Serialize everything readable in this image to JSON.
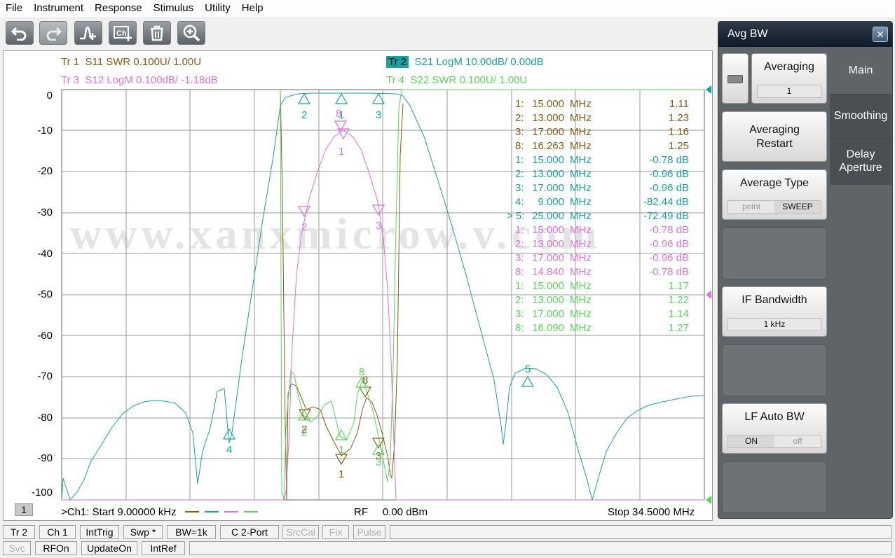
{
  "menu": [
    "File",
    "Instrument",
    "Response",
    "Stimulus",
    "Utility",
    "Help"
  ],
  "toolbar": {
    "undo_icon": "undo-icon",
    "redo_icon": "redo-icon",
    "marker_add_icon": "marker-add-icon",
    "ch_add_icon": "channel-add-icon",
    "delete_icon": "trash-icon",
    "zoom_icon": "zoom-icon",
    "ch_add_text": "Ch"
  },
  "traces": {
    "tr1": {
      "id": "Tr  1",
      "desc": "S11 SWR 0.100U/  1.00U",
      "color": "#8B5A12"
    },
    "tr2": {
      "id": "Tr  2",
      "desc": "S21 LogM 10.00dB/  0.00dB",
      "color": "#14A3A3"
    },
    "tr3": {
      "id": "Tr  3",
      "desc": "S12 LogM 0.100dB/  -1.18dB",
      "color": "#DA73DA"
    },
    "tr4": {
      "id": "Tr  4",
      "desc": "S22 SWR 0.100U/  1.00U",
      "color": "#57D957"
    }
  },
  "y_axis": [
    "0",
    "-10",
    "-20",
    "-30",
    "-40",
    "-50",
    "-60",
    "-70",
    "-80",
    "-90",
    "-100"
  ],
  "watermark": "www.xanxmicrow.v.com",
  "marker_table": [
    {
      "num": "1:",
      "freq": "15.000",
      "unit": "MHz",
      "val": "1.11",
      "trace": "tr1"
    },
    {
      "num": "2:",
      "freq": "13.000",
      "unit": "MHz",
      "val": "1.23",
      "trace": "tr1"
    },
    {
      "num": "3:",
      "freq": "17.000",
      "unit": "MHz",
      "val": "1.16",
      "trace": "tr1"
    },
    {
      "num": "8:",
      "freq": "16.263",
      "unit": "MHz",
      "val": "1.25",
      "trace": "tr1"
    },
    {
      "num": "1:",
      "freq": "15.000",
      "unit": "MHz",
      "val": "-0.78 dB",
      "trace": "tr2"
    },
    {
      "num": "2:",
      "freq": "13.000",
      "unit": "MHz",
      "val": "-0.96 dB",
      "trace": "tr2"
    },
    {
      "num": "3:",
      "freq": "17.000",
      "unit": "MHz",
      "val": "-0.96 dB",
      "trace": "tr2"
    },
    {
      "num": "4:",
      "freq": "9.000",
      "unit": "MHz",
      "val": "-82.44 dB",
      "trace": "tr2"
    },
    {
      "num": "> 5:",
      "freq": "25.000",
      "unit": "MHz",
      "val": "-72.49 dB",
      "trace": "tr2"
    },
    {
      "num": "1:",
      "freq": "15.000",
      "unit": "MHz",
      "val": "-0.78 dB",
      "trace": "tr3"
    },
    {
      "num": "2:",
      "freq": "13.000",
      "unit": "MHz",
      "val": "-0.96 dB",
      "trace": "tr3"
    },
    {
      "num": "3:",
      "freq": "17.000",
      "unit": "MHz",
      "val": "-0.96 dB",
      "trace": "tr3"
    },
    {
      "num": "8:",
      "freq": "14.840",
      "unit": "MHz",
      "val": "-0.78 dB",
      "trace": "tr3"
    },
    {
      "num": "1:",
      "freq": "15.000",
      "unit": "MHz",
      "val": "1.17",
      "trace": "tr4"
    },
    {
      "num": "2:",
      "freq": "13.000",
      "unit": "MHz",
      "val": "1.22",
      "trace": "tr4"
    },
    {
      "num": "3:",
      "freq": "17.000",
      "unit": "MHz",
      "val": "1.14",
      "trace": "tr4"
    },
    {
      "num": "8:",
      "freq": "16.090",
      "unit": "MHz",
      "val": "1.27",
      "trace": "tr4"
    }
  ],
  "channel_num": "1",
  "bottom": {
    "start": ">Ch1:  Start  9.00000 kHz",
    "rf": "RF     0.00 dBm",
    "stop": "Stop  34.5000 MHz"
  },
  "panel": {
    "title": "Avg BW",
    "close": "✕",
    "averaging": {
      "label": "Averaging",
      "value": "1"
    },
    "restart": "Averaging\nRestart",
    "avg_type": {
      "label": "Average Type",
      "opt1": "point",
      "opt2": "SWEEP"
    },
    "if_bw": {
      "label": "IF Bandwidth",
      "value": "1 kHz"
    },
    "lf_auto": {
      "label": "LF Auto BW",
      "opt1": "ON",
      "opt2": "off"
    },
    "tabs": [
      "Main",
      "Smoothing",
      "Delay\nAperture"
    ]
  },
  "status_row1": [
    "Tr 2",
    "Ch 1",
    "IntTrig",
    "Swp *",
    "BW=1k",
    "C  2-Port",
    "SrcCal",
    "Fix",
    "Pulse"
  ],
  "status_row2": [
    "Svc",
    "RFOn",
    "UpdateOn",
    "IntRef"
  ]
}
